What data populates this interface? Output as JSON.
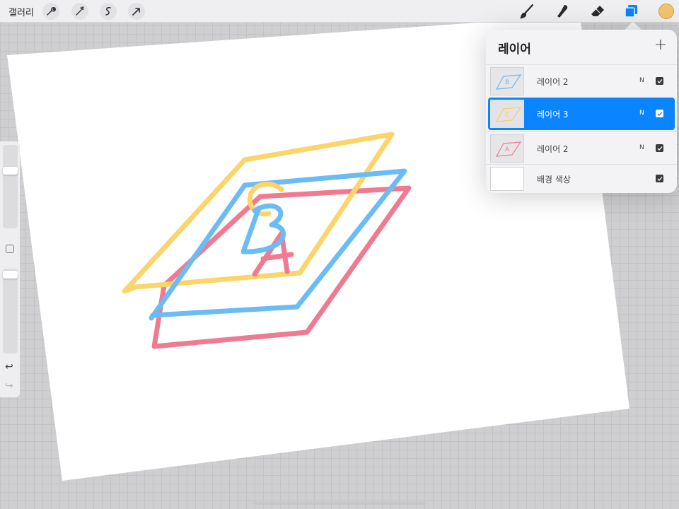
{
  "topbar": {
    "gallery_label": "갤러리",
    "left_tools": [
      "wrench-icon",
      "magic-wand-icon",
      "selection-icon",
      "transform-icon"
    ],
    "right_tools": [
      "brush-icon",
      "smudge-icon",
      "eraser-icon",
      "layers-icon"
    ],
    "active_tool": "layers-icon",
    "current_color": "#f2c26e"
  },
  "layers_panel": {
    "title": "레이어",
    "add_label": "+",
    "layers": [
      {
        "name": "레이어 2",
        "blend": "N",
        "visible": true,
        "active": false,
        "thumb_letter": "B",
        "thumb_color": "#6cb8f0"
      },
      {
        "name": "레이어 3",
        "blend": "N",
        "visible": true,
        "active": true,
        "thumb_letter": "C",
        "thumb_color": "#f5cf6a"
      },
      {
        "name": "레이어 2",
        "blend": "N",
        "visible": true,
        "active": false,
        "thumb_letter": "A",
        "thumb_color": "#f08090"
      },
      {
        "name": "배경 색상",
        "blend": "",
        "visible": true,
        "active": false,
        "thumb_letter": "",
        "thumb_color": "#ffffff"
      }
    ]
  },
  "drawing": {
    "letters": [
      "A",
      "B",
      "C"
    ],
    "colors": {
      "yellow": "#fbd46a",
      "blue": "#6bbcf5",
      "red": "#f07a90"
    }
  },
  "sidebar": {
    "undo_label": "↩",
    "redo_label": "↪"
  }
}
